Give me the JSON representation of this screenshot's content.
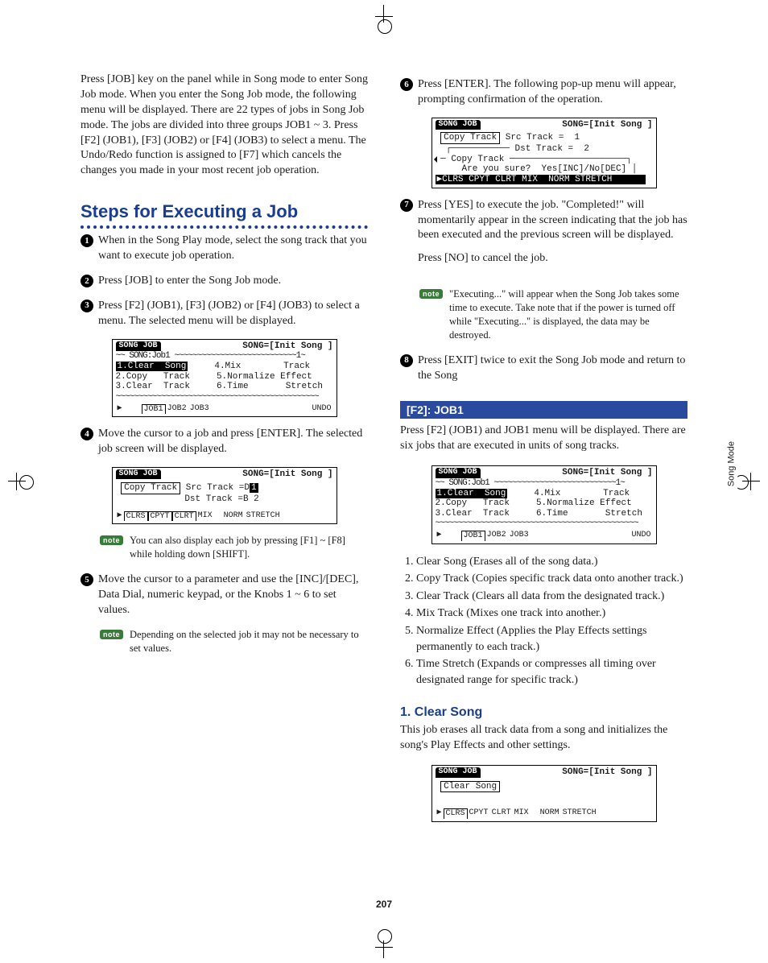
{
  "page_number": "207",
  "side_tab": "Song Mode",
  "left": {
    "intro": "Press [JOB] key on the panel while in Song mode to enter Song Job mode. When you enter the Song Job mode, the following menu will be displayed. There are 22 types of jobs in Song Job mode. The jobs are divided into three groups JOB1 ~ 3. Press [F2] (JOB1), [F3] (JOB2) or [F4] (JOB3) to select a menu. The Undo/Redo function is assigned to [F7] which cancels the changes you made in your most recent job operation.",
    "heading": "Steps for Executing a Job",
    "steps": {
      "s1": "When in the Song Play mode, select the song track that you want to execute job operation.",
      "s2": "Press [JOB] to enter the Song Job mode.",
      "s3": "Press [F2] (JOB1), [F3] (JOB2) or [F4] (JOB3) to select a menu. The selected menu will be displayed.",
      "s4": "Move the cursor to a job and press [ENTER]. The selected job screen will be displayed.",
      "s5": "Move the cursor to a parameter and use the [INC]/[DEC], Data Dial, numeric keypad, or the Knobs 1 ~ 6 to set values."
    },
    "note1": "You can also display each job by pressing [F1] ~ [F8] while holding down [SHIFT].",
    "note2": "Depending on the selected job it may not be necessary to set values.",
    "lcd_menu_title_l": "SONG JOB",
    "lcd_menu_title_r": "SONG=[Init Song ]",
    "lcd_menu_sub": "SONG:Job1",
    "lcd_menu_idx": "1",
    "lcd_menu_items": {
      "i1": "1.Clear  Song",
      "i4": "4.Mix        Track",
      "i2": "2.Copy   Track",
      "i5": "5.Normalize Effect",
      "i3": "3.Clear  Track",
      "i6": "6.Time       Stretch"
    },
    "lcd_tabs": {
      "a": "JOB1",
      "b": "JOB2",
      "c": "JOB3",
      "undo": "UNDO"
    },
    "lcd2_label": "Copy Track",
    "lcd2_src": "Src Track =D",
    "lcd2_src_v": "1",
    "lcd2_dst": "Dst Track =B 2",
    "lcd2_f": {
      "a": "CLRS",
      "b": "CPYT",
      "c": "CLRT",
      "d": "MIX",
      "e": "NORM",
      "f": "STRETCH"
    }
  },
  "right": {
    "steps": {
      "s6": "Press [ENTER]. The following pop-up menu will appear, prompting confirmation of the operation.",
      "s7": "Press [YES] to execute the job. \"Completed!\" will momentarily appear in the screen indicating that the job has been executed and the previous screen will be displayed.",
      "s7b": "Press [NO] to cancel the job.",
      "s8": "Press [EXIT] twice to exit the Song Job mode and return to the Song"
    },
    "note": "\"Executing...\" will appear when the Song Job takes some time to execute. Take note that if the power is turned off while \"Executing...\" is displayed, the data may be destroyed.",
    "lcd_popup": {
      "title_l": "SONG JOB",
      "title_r": "SONG=[Init Song ]",
      "box1": "Copy Track",
      "src": "Src Track =  1",
      "dst": "Dst Track =  2",
      "label": "Copy Track",
      "confirm": "Are you sure?  Yes[INC]/No[DEC]"
    },
    "bar": "[F2]: JOB1",
    "bar_text": "Press [F2] (JOB1) and JOB1 menu will be displayed. There are six jobs that are executed in units of song tracks.",
    "joblist": {
      "j1": "Clear Song (Erases all of the song data.)",
      "j2": "Copy Track (Copies specific track data onto another track.)",
      "j3": "Clear Track (Clears all data from the designated track.)",
      "j4": "Mix Track (Mixes one track into another.)",
      "j5": "Normalize Effect (Applies the Play Effects settings permanently to each track.)",
      "j6": "Time Stretch (Expands or compresses all timing over designated range for specific track.)"
    },
    "sub": "1. Clear Song",
    "sub_text": "This job erases all track data from a song and initializes the song's Play Effects and other settings.",
    "lcd_clear": {
      "label": "Clear Song"
    }
  },
  "note_tag": "note"
}
